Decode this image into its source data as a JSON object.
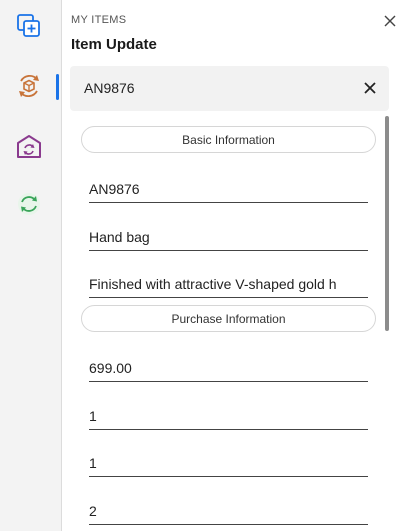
{
  "rail": {
    "items": [
      {
        "name": "add-copy-icon",
        "color": "#1a73e8"
      },
      {
        "name": "package-sync-icon",
        "color": "#c8743a"
      },
      {
        "name": "warehouse-sync-icon",
        "color": "#8a3a8e"
      },
      {
        "name": "refresh-icon",
        "color": "#3aa45a"
      }
    ],
    "active_index": 1
  },
  "header": {
    "eyebrow": "MY ITEMS",
    "title": "Item Update",
    "close_icon": "close-icon"
  },
  "item_selector": {
    "value": "AN9876",
    "clear_icon": "close-icon"
  },
  "sections": {
    "basic": "Basic Information",
    "purchase": "Purchase Information"
  },
  "fields": {
    "item_code": "AN9876",
    "item_name": "Hand bag",
    "description": "Finished with attractive V-shaped gold h",
    "purchase_price": "699.00",
    "purchase_field_2": "1",
    "purchase_field_3": "1",
    "purchase_field_4": "2"
  },
  "colors": {
    "accent": "#1a73e8",
    "selector_bg": "#f2f2f2"
  }
}
